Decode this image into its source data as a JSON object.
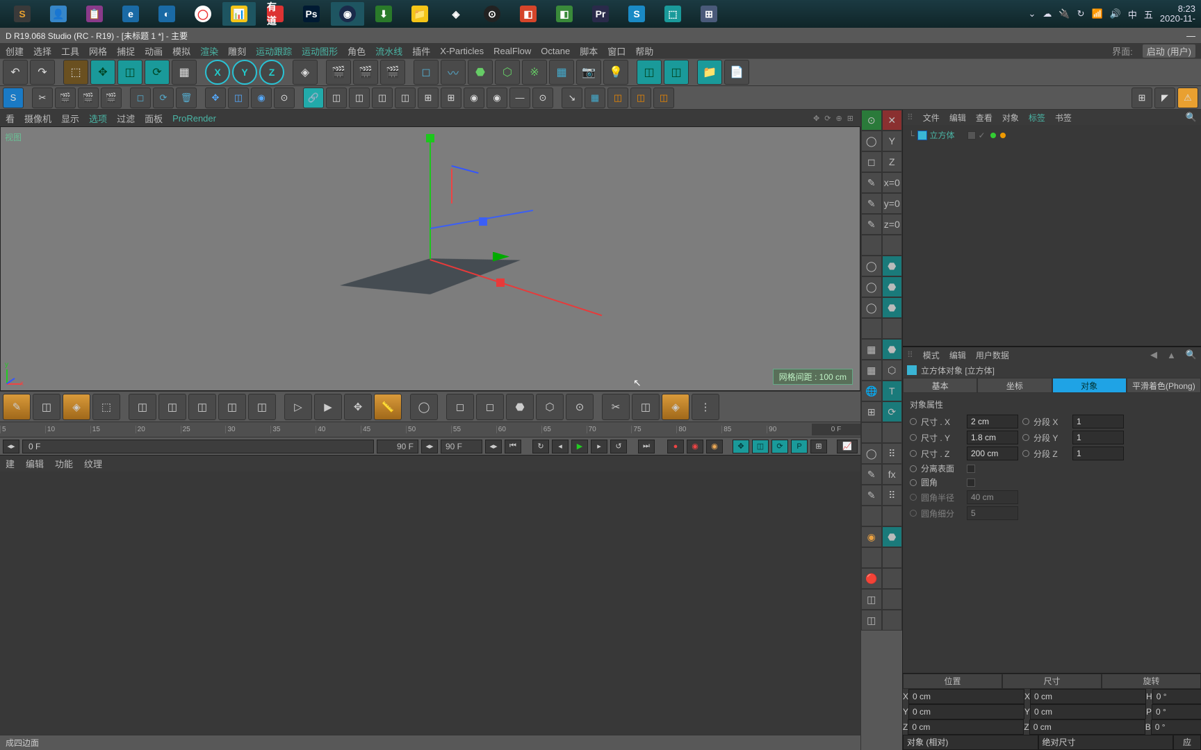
{
  "taskbar": {
    "time": "8:23",
    "date": "2020-11-",
    "ime": "中",
    "tray_char": "五"
  },
  "titlebar": {
    "text": "D R19.068 Studio (RC - R19) - [未标题 1 *] - 主要"
  },
  "menu": {
    "items": [
      "创建",
      "选择",
      "工具",
      "网格",
      "捕捉",
      "动画",
      "模拟",
      "渲染",
      "雕刻",
      "运动跟踪",
      "运动图形",
      "角色",
      "流水线",
      "插件",
      "X-Particles",
      "RealFlow",
      "Octane",
      "脚本",
      "窗口",
      "帮助"
    ],
    "teal_idx": [
      7,
      9,
      10,
      12
    ],
    "right_label": "界面:",
    "layout": "启动 (用户)"
  },
  "vp_menu": {
    "items": [
      "看",
      "摄像机",
      "显示",
      "选项",
      "过滤",
      "面板",
      "ProRender"
    ],
    "active_idx": 3,
    "pr_idx": 6
  },
  "viewport": {
    "label": "视图",
    "grid_badge": "网格间距 : 100 cm"
  },
  "timeline": {
    "ticks": [
      "5",
      "10",
      "15",
      "20",
      "25",
      "30",
      "35",
      "40",
      "45",
      "50",
      "55",
      "60",
      "65",
      "70",
      "75",
      "80",
      "85",
      "90"
    ],
    "end": "0 F",
    "start_field": "0 F",
    "end_field": "90 F",
    "cur_field": "90 F"
  },
  "matbar": {
    "items": [
      "建",
      "编辑",
      "功能",
      "纹理"
    ]
  },
  "statusbar": {
    "text": "成四边面"
  },
  "objmgr": {
    "menu": [
      "文件",
      "编辑",
      "查看",
      "对象",
      "标签",
      "书签"
    ],
    "hl_idx": 4,
    "tree_item": "立方体"
  },
  "attrmgr": {
    "menu": [
      "模式",
      "编辑",
      "用户数据"
    ],
    "title": "立方体对象 [立方体]",
    "tabs": [
      "基本",
      "坐标",
      "对象",
      "平滑着色(Phong)"
    ],
    "active_tab": 2,
    "section": "对象属性",
    "size_x_label": "尺寸 . X",
    "size_x": "2 cm",
    "seg_x_label": "分段 X",
    "seg_x": "1",
    "size_y_label": "尺寸 . Y",
    "size_y": "1.8 cm",
    "seg_y_label": "分段 Y",
    "seg_y": "1",
    "size_z_label": "尺寸 . Z",
    "size_z": "200 cm",
    "seg_z_label": "分段 Z",
    "seg_z": "1",
    "sep_face": "分离表面",
    "fillet": "圆角",
    "fillet_r_label": "圆角半径",
    "fillet_r": "40 cm",
    "fillet_s_label": "圆角细分",
    "fillet_s": "5"
  },
  "coords": {
    "heads": [
      "位置",
      "尺寸",
      "旋转"
    ],
    "rows": [
      {
        "a": "X",
        "p": "0 cm",
        "sa": "X",
        "s": "0 cm",
        "ra": "H",
        "r": "0 °"
      },
      {
        "a": "Y",
        "p": "0 cm",
        "sa": "Y",
        "s": "0 cm",
        "ra": "P",
        "r": "0 °"
      },
      {
        "a": "Z",
        "p": "0 cm",
        "sa": "Z",
        "s": "0 cm",
        "ra": "B",
        "r": "0 °"
      }
    ],
    "foot_l": "对象 (相对)",
    "foot_m": "绝对尺寸",
    "foot_r": "应"
  }
}
